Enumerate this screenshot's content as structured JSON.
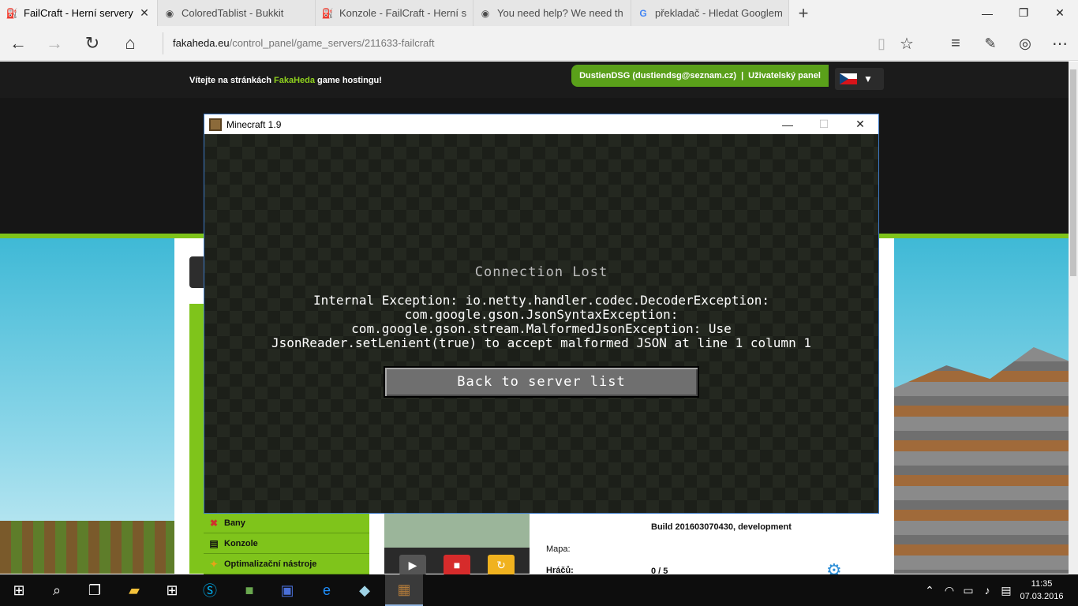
{
  "browser": {
    "tabs": [
      {
        "title": "FailCraft - Herní servery",
        "icon": "fakaheda-icon",
        "active": true
      },
      {
        "title": "ColoredTablist - Bukkit",
        "icon": "bukkit-icon",
        "active": false
      },
      {
        "title": "Konzole - FailCraft - Herní s",
        "icon": "fakaheda-icon",
        "active": false
      },
      {
        "title": "You need help? We need th",
        "icon": "bukkit-icon",
        "active": false
      },
      {
        "title": "překladač - Hledat Googlem",
        "icon": "google-icon",
        "active": false
      }
    ],
    "close_glyph": "✕",
    "new_tab_glyph": "+",
    "url_host": "fakaheda.eu",
    "url_path": "/control_panel/game_servers/211633-failcraft"
  },
  "site": {
    "welcome_prefix": "Vítejte na stránkách ",
    "welcome_brand": "FakaHeda",
    "welcome_suffix": " game hostingu!",
    "user": "DustienDSG (dustiendsg@seznam.cz)",
    "separator": "|",
    "user_panel": "Uživatelský panel",
    "menu": [
      {
        "label": "Bany",
        "icon": "ban-icon"
      },
      {
        "label": "Konzole",
        "icon": "console-icon"
      },
      {
        "label": "Optimalizační nástroje",
        "icon": "wand-icon"
      }
    ],
    "build": "Build 201603070430, development",
    "map_label": "Mapa:",
    "players_label": "Hráčů:",
    "players_value": "0 / 5",
    "colors": {
      "brand_green": "#7fc41b",
      "header_dark": "#1b1b1b"
    }
  },
  "minecraft": {
    "window_title": "Minecraft 1.9",
    "heading": "Connection Lost",
    "message_lines": [
      "Internal Exception: io.netty.handler.codec.DecoderException:",
      "com.google.gson.JsonSyntaxException:",
      "com.google.gson.stream.MalformedJsonException: Use",
      "JsonReader.setLenient(true) to accept malformed JSON at line 1 column 1"
    ],
    "button_label": "Back to server list"
  },
  "taskbar": {
    "time": "11:35",
    "date": "07.03.2016"
  }
}
